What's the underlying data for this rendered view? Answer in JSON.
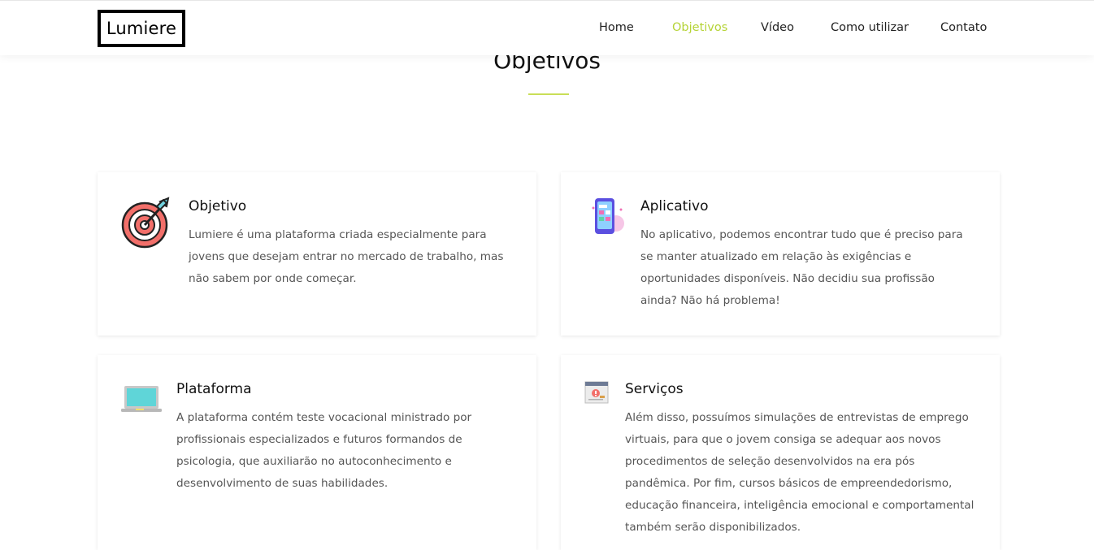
{
  "brand": {
    "logo": "Lumiere"
  },
  "nav": {
    "home": "Home",
    "objetivos": "Objetivos",
    "video": "Vídeo",
    "como_utilizar": "Como utilizar",
    "contato": "Contato",
    "active": "Objetivos"
  },
  "section": {
    "title": "Objetivos"
  },
  "cards": [
    {
      "title": "Objetivo",
      "text": "Lumiere é uma plataforma criada especialmente para jovens que desejam entrar no mercado de trabalho, mas não sabem por onde começar.",
      "icon": "target-dart-icon"
    },
    {
      "title": "Aplicativo",
      "text": "No aplicativo, podemos encontrar tudo que é preciso para se manter atualizado em relação às exigências e oportunidades disponíveis. Não decidiu sua profissão ainda? Não há problema!",
      "icon": "smartphone-app-icon"
    },
    {
      "title": "Plataforma",
      "text": "A plataforma contém teste vocacional ministrado por profissionais especializados e futuros formandos de psicologia, que auxiliarão no autoconhecimento e desenvolvimento de suas habilidades.",
      "icon": "laptop-icon"
    },
    {
      "title": "Serviços",
      "text": "Além disso, possuímos simulações de entrevistas de emprego virtuais, para que o jovem consiga se adequar aos novos procedimentos de seleção desenvolvidos na era pós pandêmica. Por fim, cursos básicos de empreendedorismo, educação financeira, inteligência emocional e comportamental também serão disponibilizados.",
      "icon": "browser-window-icon"
    }
  ],
  "colors": {
    "accent": "#b5d336",
    "underline": "#c9de57",
    "text": "#555555",
    "heading": "#111111"
  }
}
